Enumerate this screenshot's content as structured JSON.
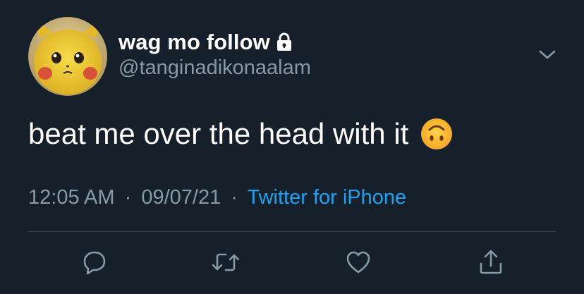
{
  "tweet": {
    "display_name": "wag mo follow",
    "handle": "@tanginadikonaalam",
    "text": "beat me over the head with it",
    "emoji": "upside-down-face",
    "time": "12:05 AM",
    "separator": "·",
    "date": "09/07/21",
    "source": "Twitter for iPhone"
  },
  "icons": {
    "lock": "lock-icon",
    "menu": "chevron-down-icon",
    "reply": "reply-icon",
    "retweet": "retweet-icon",
    "like": "heart-icon",
    "share": "share-icon"
  },
  "colors": {
    "background": "#15202b",
    "secondary_text": "#8899a6",
    "link": "#1da1f2",
    "divider": "#38444d"
  }
}
